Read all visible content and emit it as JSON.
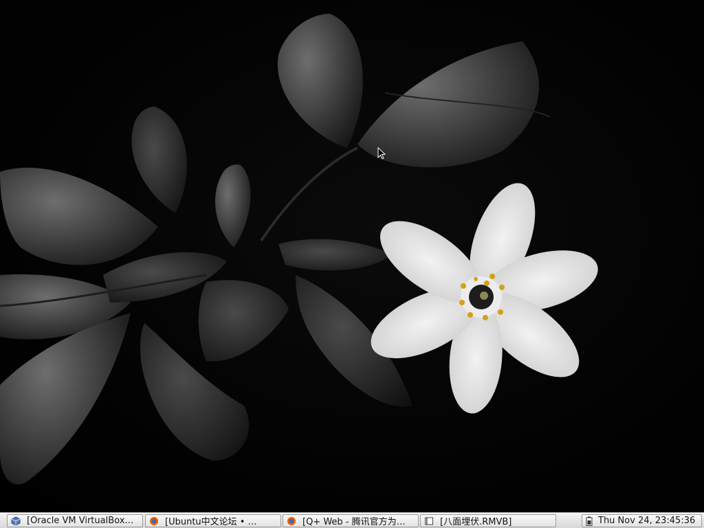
{
  "desktop": {
    "wallpaper": "dark-leaves-white-flower-wallpaper",
    "cursor": "arrow-cursor-icon"
  },
  "taskbar": {
    "tasks": [
      {
        "label": "[Oracle VM VirtualBox…",
        "icon": "virtualbox-icon"
      },
      {
        "label": "[Ubuntu中文论坛 • …",
        "icon": "firefox-icon"
      },
      {
        "label": "[Q+ Web - 腾讯官方为…",
        "icon": "firefox-icon"
      },
      {
        "label": "[八面埋伏.RMVB]",
        "icon": "media-player-icon"
      }
    ],
    "clock": {
      "text": "Thu Nov 24, 23:45:36",
      "icon": "battery-icon"
    }
  },
  "colors": {
    "taskbar_bg": "#e6e6e6",
    "desktop_bg": "#000000",
    "firefox_orange": "#e66000",
    "stamen_yellow": "#d4a017"
  }
}
